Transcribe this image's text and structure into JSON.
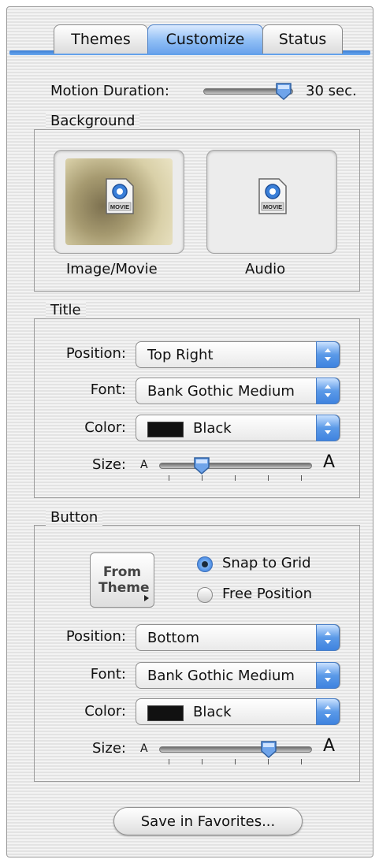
{
  "tabs": [
    {
      "label": "Themes",
      "selected": false
    },
    {
      "label": "Customize",
      "selected": true
    },
    {
      "label": "Status",
      "selected": false
    }
  ],
  "motion": {
    "label": "Motion Duration:",
    "value_text": "30 sec.",
    "level": 0.83
  },
  "background": {
    "title": "Background",
    "image_well": {
      "label": "Image/Movie",
      "icon_text": "MOVIE"
    },
    "audio_well": {
      "label": "Audio",
      "icon_text": "MOVIE"
    }
  },
  "title_group": {
    "title": "Title",
    "position": {
      "label": "Position:",
      "value": "Top Right"
    },
    "font": {
      "label": "Font:",
      "value": "Bank Gothic Medium"
    },
    "color": {
      "label": "Color:",
      "value": "Black",
      "swatch": "#111111"
    },
    "size": {
      "label": "Size:",
      "small": "A",
      "large": "A",
      "level": 0.28
    }
  },
  "button_group": {
    "title": "Button",
    "from_theme": "From Theme",
    "snap": {
      "label": "Snap to Grid",
      "selected": true
    },
    "free": {
      "label": "Free Position",
      "selected": false
    },
    "position": {
      "label": "Position:",
      "value": "Bottom"
    },
    "font": {
      "label": "Font:",
      "value": "Bank Gothic Medium"
    },
    "color": {
      "label": "Color:",
      "value": "Black",
      "swatch": "#111111"
    },
    "size": {
      "label": "Size:",
      "small": "A",
      "large": "A",
      "level": 0.72
    }
  },
  "save_button": "Save in Favorites...",
  "colors": {
    "accent": "#3f83df",
    "tab_active": "#8fbef5"
  }
}
